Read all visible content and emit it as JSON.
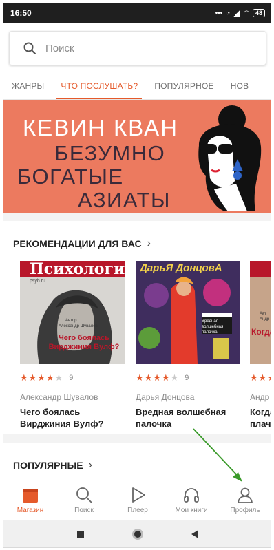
{
  "status": {
    "time": "16:50",
    "battery": "48"
  },
  "search": {
    "placeholder": "Поиск"
  },
  "tabs": [
    {
      "label": "ЖАНРЫ"
    },
    {
      "label": "ЧТО ПОСЛУШАТЬ?"
    },
    {
      "label": "ПОПУЛЯРНОЕ"
    },
    {
      "label": "НОВ"
    }
  ],
  "banner": {
    "author": "КЕВИН КВАН",
    "line1": "БЕЗУМНО",
    "line2": "БОГАТЫЕ",
    "line3": "АЗИАТЫ"
  },
  "recommendations": {
    "title": "РЕКОМЕНДАЦИИ ДЛЯ ВАС",
    "books": [
      {
        "cover_title": "Психология",
        "cover_site": "psyh.ru",
        "cover_small1": "Автор",
        "cover_small2": "Александр Шувалов",
        "cover_text": "Чего боялась Вирджиния Вулф?",
        "stars": "★★★★",
        "stars_off": "★",
        "rating_count": "9",
        "author": "Александр Шувалов",
        "title": "Чего боялась Вирджиния Вулф?"
      },
      {
        "cover_title": "ДарьЯ ДонцовА",
        "cover_text": "Вредная волшебная палочка",
        "stars": "★★★★",
        "stars_off": "★",
        "rating_count": "9",
        "author": "Дарья Донцова",
        "title": "Вредная волшебная палочка"
      },
      {
        "cover_small1": "Авт",
        "cover_small2": "Андр",
        "cover_text": "Когда",
        "stars": "★★★",
        "stars_off": "",
        "rating_count": "",
        "author": "Андр",
        "title": "Когда плачу"
      }
    ]
  },
  "popular": {
    "title": "ПОПУЛЯРНЫЕ"
  },
  "bottom_nav": [
    {
      "label": "Магазин",
      "icon": "shop-icon"
    },
    {
      "label": "Поиск",
      "icon": "search-icon"
    },
    {
      "label": "Плеер",
      "icon": "play-icon"
    },
    {
      "label": "Мои книги",
      "icon": "headphones-icon"
    },
    {
      "label": "Профиль",
      "icon": "profile-icon"
    }
  ],
  "colors": {
    "accent": "#e55a2b",
    "banner": "#ec7a5f",
    "arrow": "#3a9a2a"
  }
}
